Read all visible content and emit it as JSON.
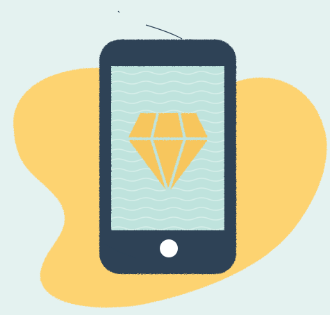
{
  "illustration": {
    "subject": "",
    "icons": [
      "smartphone-icon",
      "diamond-icon",
      "home-button-icon"
    ]
  },
  "colors": {
    "background": "#e4f2f0",
    "blob": "#fdd371",
    "phone_body": "#2d4257",
    "screen": "#bfe3dd",
    "diamond": "#f7c65d",
    "diamond_lines": "#bfe3dd",
    "button": "#ffffff"
  }
}
